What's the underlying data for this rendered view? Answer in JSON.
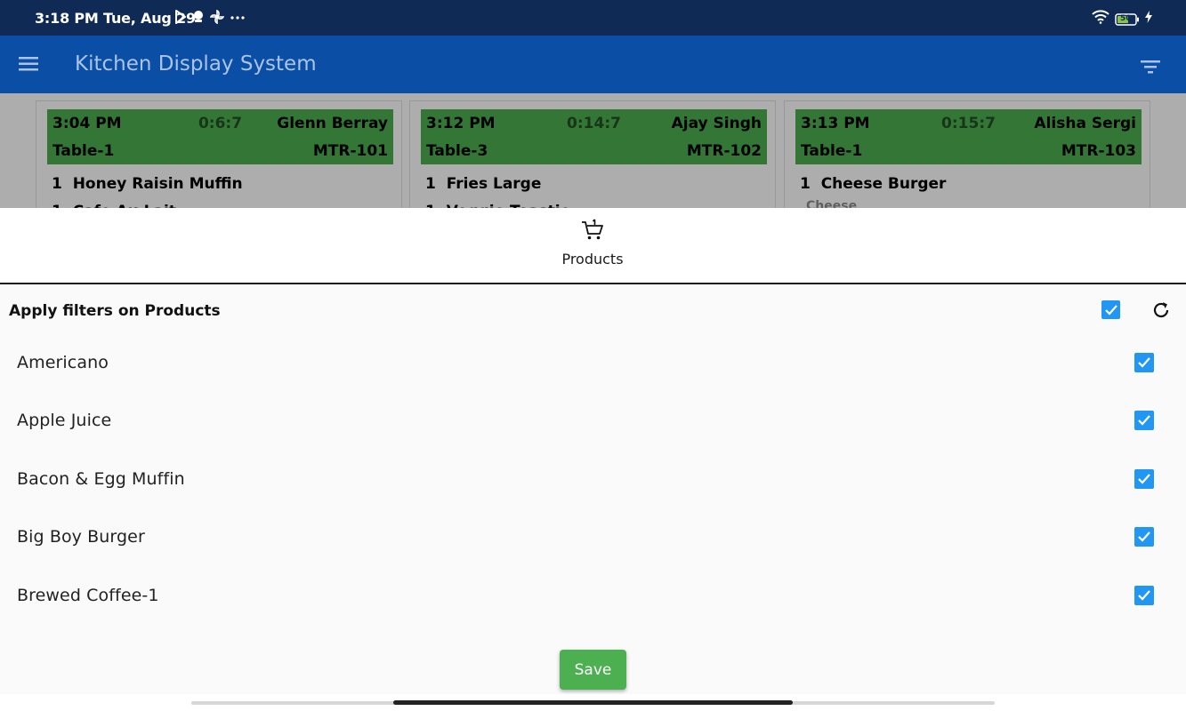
{
  "status_bar": {
    "time": "3:18 PM Tue, Aug 29",
    "battery": "50"
  },
  "app_bar": {
    "title": "Kitchen Display System"
  },
  "orders": [
    {
      "time": "3:04 PM",
      "timer": "0:6:7",
      "customer": "Glenn Berray",
      "table": "Table-1",
      "order_id": "MTR-101",
      "items": [
        {
          "qty": "1",
          "name": "Honey Raisin Muffin"
        },
        {
          "qty": "1",
          "name": "Cafe Au Lait"
        }
      ],
      "modifier": ""
    },
    {
      "time": "3:12 PM",
      "timer": "0:14:7",
      "customer": "Ajay Singh",
      "table": "Table-3",
      "order_id": "MTR-102",
      "items": [
        {
          "qty": "1",
          "name": "Fries Large"
        },
        {
          "qty": "1",
          "name": "Veggie Toastie"
        }
      ],
      "modifier": ""
    },
    {
      "time": "3:13 PM",
      "timer": "0:15:7",
      "customer": "Alisha Sergi",
      "table": "Table-1",
      "order_id": "MTR-103",
      "items": [
        {
          "qty": "1",
          "name": "Cheese Burger"
        }
      ],
      "modifier": "Cheese"
    }
  ],
  "sheet": {
    "tab_label": "Products",
    "filter_header": "Apply filters on Products",
    "products": [
      {
        "name": "Americano",
        "checked": true
      },
      {
        "name": "Apple Juice",
        "checked": true
      },
      {
        "name": "Bacon & Egg Muffin",
        "checked": true
      },
      {
        "name": "Big Boy Burger",
        "checked": true
      },
      {
        "name": "Brewed Coffee-1",
        "checked": true
      }
    ],
    "save_label": "Save"
  },
  "colors": {
    "status_bar": "#0f2b55",
    "app_bar": "#0a4ea5",
    "order_header": "#4caf50",
    "checkbox": "#2196f3",
    "save_button": "#4caf50"
  }
}
